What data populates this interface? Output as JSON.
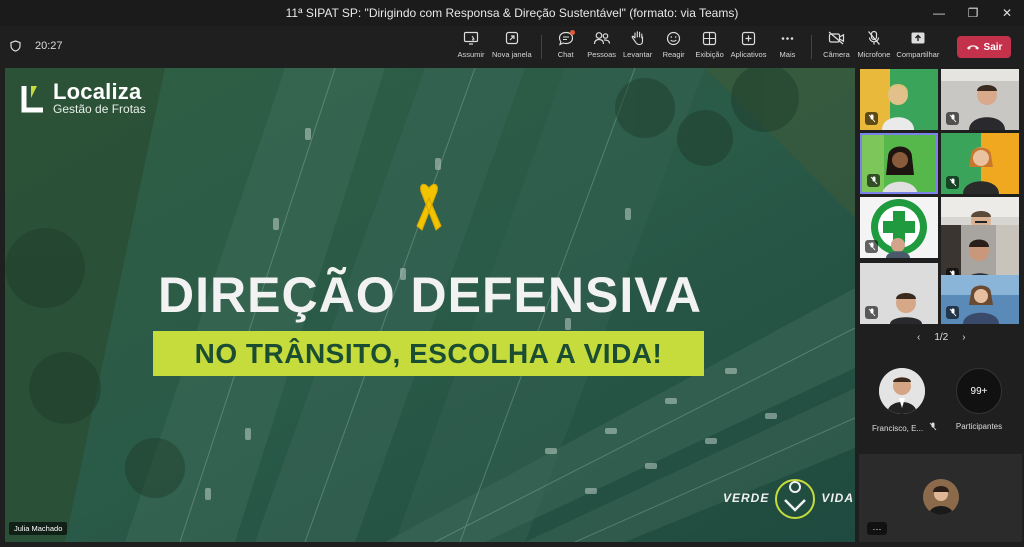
{
  "window": {
    "title": "11ª SIPAT SP: \"Dirigindo com Responsa & Direção Sustentável\" (formato: via Teams)"
  },
  "toolbar": {
    "timer": "20:27",
    "buttons": [
      {
        "label": "Assumir",
        "icon": "take-control-icon"
      },
      {
        "label": "Nova janela",
        "icon": "new-window-icon"
      },
      {
        "label": "Chat",
        "icon": "chat-icon"
      },
      {
        "label": "Pessoas",
        "icon": "people-icon"
      },
      {
        "label": "Levantar",
        "icon": "raise-hand-icon"
      },
      {
        "label": "Reagir",
        "icon": "react-icon"
      },
      {
        "label": "Exibição",
        "icon": "view-icon"
      },
      {
        "label": "Aplicativos",
        "icon": "apps-icon"
      },
      {
        "label": "Mais",
        "icon": "more-icon"
      },
      {
        "label": "Câmera",
        "icon": "camera-off-icon"
      },
      {
        "label": "Microfone",
        "icon": "mic-off-icon"
      },
      {
        "label": "Compartilhar",
        "icon": "share-icon"
      }
    ],
    "leave_label": "Sair",
    "leave_color": "#c4314b"
  },
  "slide": {
    "brand_name": "Localiza",
    "brand_sub": "Gestão de Frotas",
    "headline": "DIREÇÃO DEFENSIVA",
    "tagline": "NO TRÂNSITO, ESCOLHA A VIDA!",
    "logo_left": "VERDE",
    "logo_right": "VIDA",
    "accent": "#c6db3c",
    "ribbon_color": "#f2c300"
  },
  "stage": {
    "presenter_name": "Julia Machado"
  },
  "panel": {
    "pager": "1/2",
    "pinned_name": "Francisco, E...",
    "participants_count": "99+",
    "participants_label": "Participantes",
    "self_more": "···"
  }
}
